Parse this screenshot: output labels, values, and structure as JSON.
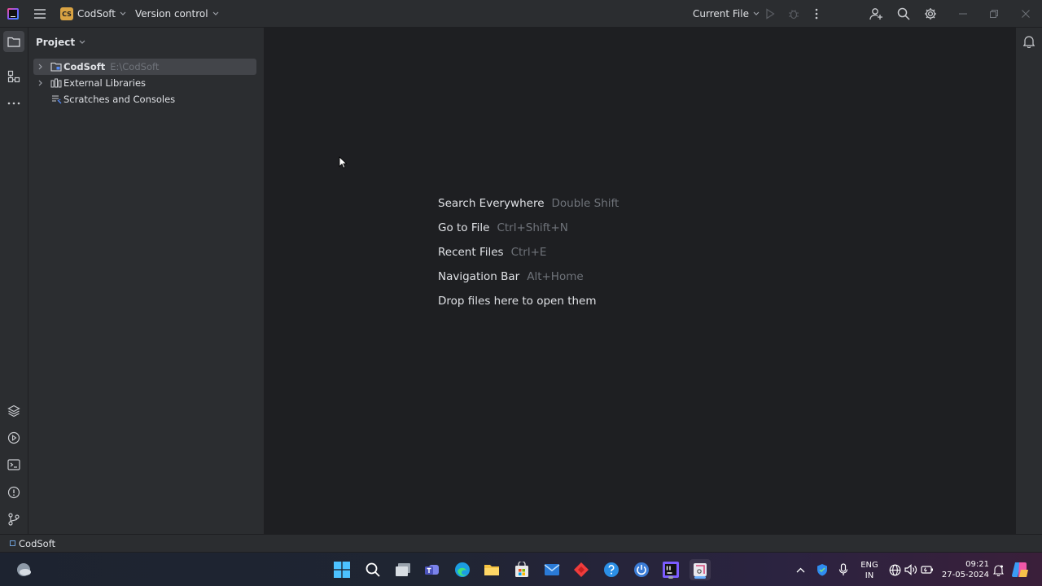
{
  "titlebar": {
    "project_badge": "CS",
    "project_name": "CodSoft",
    "vcs_label": "Version control",
    "run_config": "Current File"
  },
  "left_strip": {
    "top": [
      "folder-icon",
      "structure-icon",
      "more-icon"
    ],
    "bottom": [
      "layers-icon",
      "run-services-icon",
      "terminal-icon",
      "problems-icon",
      "git-icon"
    ]
  },
  "project_panel": {
    "title": "Project",
    "tree": [
      {
        "label": "CodSoft",
        "path": "E:\\CodSoft",
        "expandable": true,
        "selected": true,
        "icon": "folder-icon"
      },
      {
        "label": "External Libraries",
        "path": "",
        "expandable": true,
        "selected": false,
        "icon": "library-icon"
      },
      {
        "label": "Scratches and Consoles",
        "path": "",
        "expandable": false,
        "selected": false,
        "icon": "scratches-icon"
      }
    ]
  },
  "editor": {
    "hints": [
      {
        "action": "Search Everywhere",
        "shortcut": "Double Shift"
      },
      {
        "action": "Go to File",
        "shortcut": "Ctrl+Shift+N"
      },
      {
        "action": "Recent Files",
        "shortcut": "Ctrl+E"
      },
      {
        "action": "Navigation Bar",
        "shortcut": "Alt+Home"
      },
      {
        "action": "Drop files here to open them",
        "shortcut": ""
      }
    ]
  },
  "statusbar": {
    "breadcrumb": "CodSoft"
  },
  "taskbar": {
    "lang_line1": "ENG",
    "lang_line2": "IN",
    "time": "09:21",
    "date": "27-05-2024"
  },
  "colors": {
    "accent_blue": "#3574f0",
    "project_badge": "#d9a343",
    "panel_bg": "#2b2d30",
    "editor_bg": "#1e1f22"
  }
}
